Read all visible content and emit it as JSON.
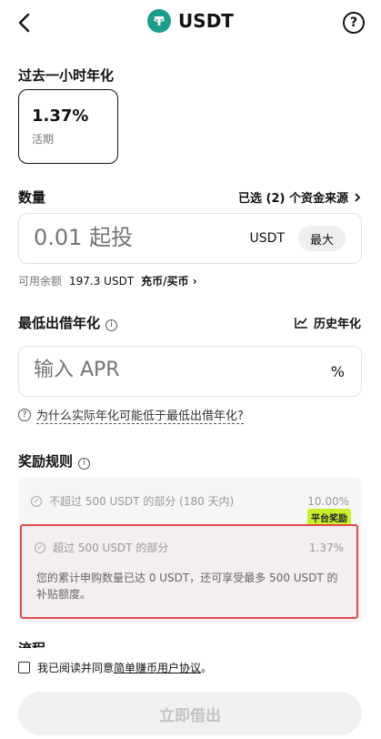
{
  "header": {
    "title": "USDT"
  },
  "rate": {
    "label": "过去一小时年化",
    "value": "1.37%",
    "type": "活期"
  },
  "quantity": {
    "label": "数量",
    "sources": "已选 (2) 个资金来源",
    "placeholder": "0.01 起投",
    "unit": "USDT",
    "max": "最大",
    "balance_label": "可用余额",
    "balance_value": "197.3 USDT",
    "topup": "充币/买币"
  },
  "min_apr": {
    "label": "最低出借年化",
    "history": "历史年化",
    "placeholder": "输入 APR",
    "unit": "%",
    "why": "为什么实际年化可能低于最低出借年化?"
  },
  "rewards": {
    "label": "奖励规则",
    "tier1_text": "不超过 500 USDT 的部分 (180 天内)",
    "tier1_pct": "10.00%",
    "platform_tag": "平台奖励",
    "tier2_text": "超过 500 USDT 的部分",
    "tier2_pct": "1.37%",
    "hint": "您的累计申购数量已达 0 USDT，还可享受最多 500 USDT 的补贴额度。"
  },
  "next_section": "流程",
  "agreement": {
    "prefix": "我已阅读并同意",
    "link": "简单赚币用户协议",
    "suffix": "。"
  },
  "submit": "立即借出",
  "colors": {
    "accent_green": "#1a9e8b",
    "tag_lime": "#c9ef2b",
    "highlight_red": "#e04a4a"
  },
  "icons": [
    "back-arrow-icon",
    "usdt-coin-icon",
    "help-icon",
    "chevron-right-icon",
    "info-icon",
    "chart-icon",
    "question-icon",
    "check-circle-icon",
    "checkbox-icon"
  ]
}
